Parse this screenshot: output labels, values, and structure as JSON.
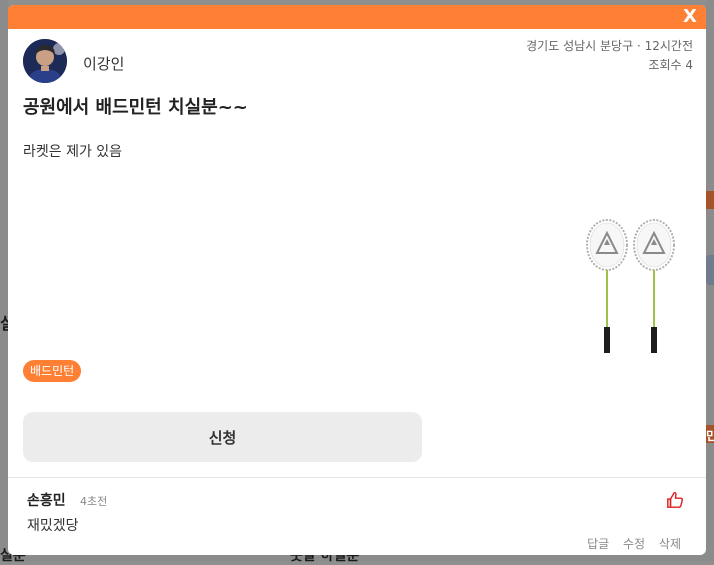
{
  "post": {
    "author": "이강인",
    "location": "경기도 성남시 분당구",
    "time_ago": "12시간전",
    "views": "조회수 4",
    "title": "공원에서 배드민턴 치실분~~",
    "body": "라켓은 제가 있음",
    "tag": "배드민턴",
    "apply_label": "신청",
    "close_label": "X"
  },
  "comment": {
    "author": "손흥민",
    "time_ago": "4초전",
    "text": "재밌겠당",
    "actions": [
      "답글",
      "수정",
      "삭제"
    ]
  },
  "colors": {
    "accent": "#ff7f34",
    "like": "#e02020"
  },
  "background": {
    "fragment_left": "실",
    "fragment_bottom_left": "실분",
    "fragment_bottom_mid": "풋살 하실분",
    "fragment_right": "민"
  }
}
